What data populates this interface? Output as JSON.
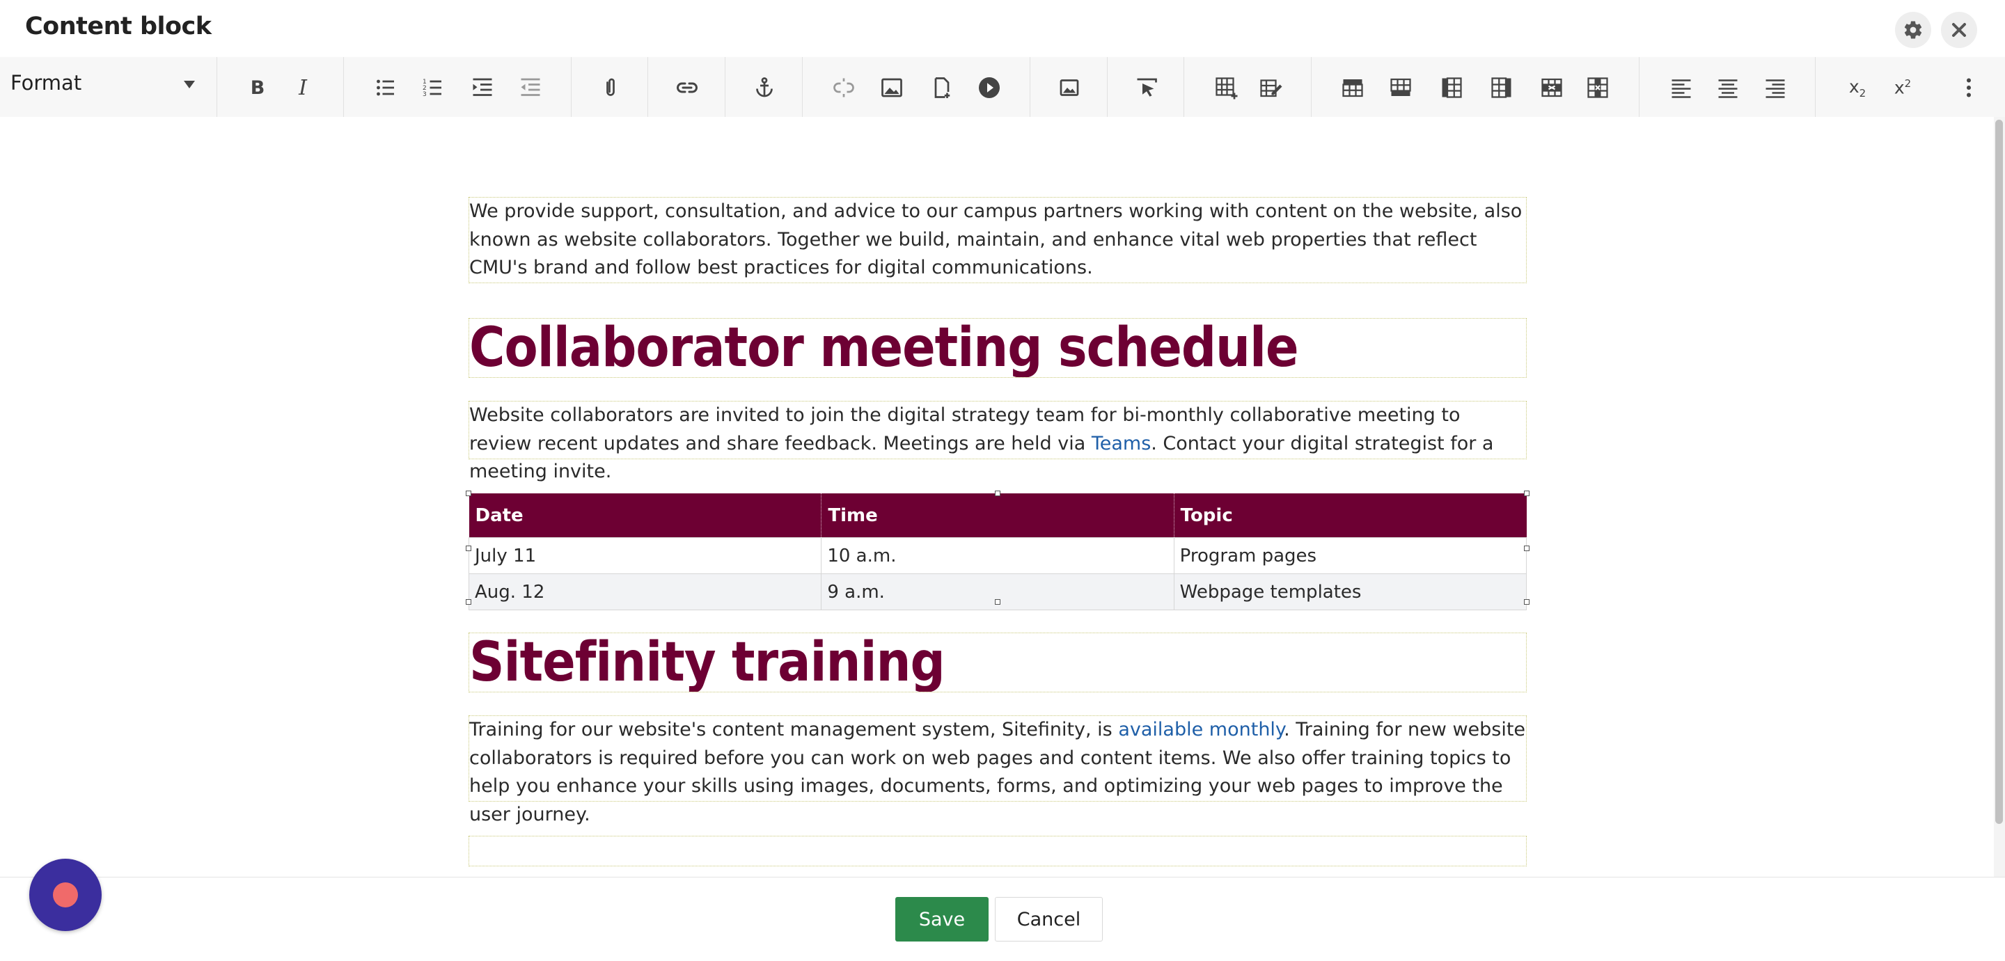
{
  "window": {
    "title": "Content block"
  },
  "toolbar": {
    "format_label": "Format",
    "icons": [
      "bold-icon",
      "italic-icon",
      "bulleted-list-icon",
      "numbered-list-icon",
      "indent-icon",
      "outdent-icon",
      "paperclip-icon",
      "link-icon",
      "anchor-icon",
      "unlink-icon",
      "image-icon",
      "document-icon",
      "video-icon",
      "image-gallery-icon",
      "cursor-icon",
      "insert-table-icon",
      "table-properties-icon",
      "insert-row-above-icon",
      "insert-row-below-icon",
      "insert-column-left-icon",
      "insert-column-right-icon",
      "delete-row-icon",
      "delete-column-icon",
      "align-left-icon",
      "align-center-icon",
      "align-right-icon",
      "subscript-icon",
      "superscript-icon",
      "more-icon"
    ]
  },
  "content": {
    "intro": "We provide support, consultation, and advice to our campus partners working with content on the website, also known as website collaborators. Together we build, maintain, and enhance vital web properties that reflect CMU's brand and follow best practices for digital communications.",
    "heading1": "Collaborator meeting schedule",
    "para2_before": "Website collaborators are invited to join the digital strategy team for bi-monthly collaborative meeting to review recent updates and share feedback. Meetings are held via ",
    "para2_link": "Teams",
    "para2_after": ". Contact your digital strategist for a meeting invite.",
    "table": {
      "headers": [
        "Date",
        "Time",
        "Topic"
      ],
      "rows": [
        [
          "July 11",
          "10 a.m.",
          "Program pages"
        ],
        [
          "Aug. 12",
          "9 a.m.",
          "Webpage templates"
        ]
      ]
    },
    "heading2": "Sitefinity training",
    "para3_before": "Training for our website's content management system, Sitefinity, is ",
    "para3_link": "available monthly",
    "para3_after": ". Training for new website collaborators is required before you can work on web pages and content items. We also offer training topics to help you enhance your skills using images, documents, forms, and optimizing your web pages to improve the user journey."
  },
  "footer": {
    "save_label": "Save",
    "cancel_label": "Cancel"
  },
  "colors": {
    "heading": "#6d0033",
    "table_header": "#6d0033",
    "save": "#2c8a4b",
    "link": "#1f5fa8",
    "record_button": "#3b2e9e"
  }
}
